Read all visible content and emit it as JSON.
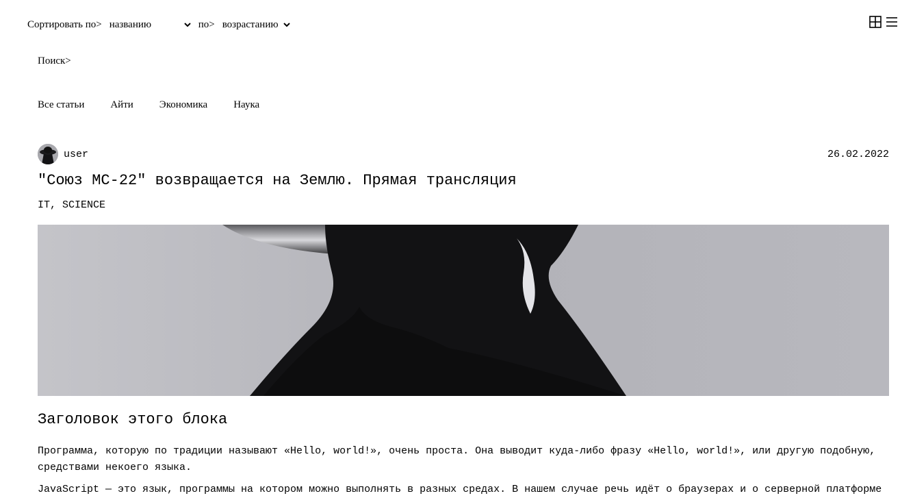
{
  "sort": {
    "label": "Сортировать по>",
    "field_value": "названию",
    "by_label": "по>",
    "order_value": "возрастанию"
  },
  "view_icons": [
    "grid-view-icon",
    "list-view-icon"
  ],
  "search": {
    "label": "Поиск>"
  },
  "categories": [
    "Все статьи",
    "Айти",
    "Экономика",
    "Наука"
  ],
  "article": {
    "author": "user",
    "date": "26.02.2022",
    "title": "\"Союз МС-22\" возвращается на Землю. Прямая трансляция",
    "tags": "IT, SCIENCE",
    "block_title": "Заголовок этого блока",
    "paragraphs": [
      "Программа, которую по традиции называют «Hello, world!», очень проста. Она выводит куда-либо фразу «Hello, world!», или другую подобную, средствами некоего языка.",
      "JavaScript — это язык, программы на котором можно выполнять в разных средах. В нашем случае речь идёт о браузерах и о серверной платформе"
    ]
  }
}
